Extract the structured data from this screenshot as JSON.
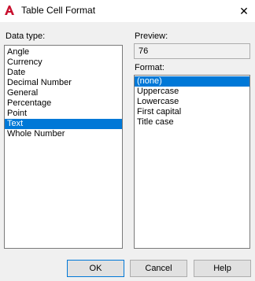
{
  "window": {
    "title": "Table Cell Format",
    "app_icon": "autocad-a-icon",
    "close_glyph": "✕"
  },
  "data_type": {
    "label": "Data type:",
    "items": [
      "Angle",
      "Currency",
      "Date",
      "Decimal Number",
      "General",
      "Percentage",
      "Point",
      "Text",
      "Whole Number"
    ],
    "selected": "Text"
  },
  "preview": {
    "label": "Preview:",
    "value": "76"
  },
  "format": {
    "label": "Format:",
    "items": [
      "(none)",
      "Uppercase",
      "Lowercase",
      "First capital",
      "Title case"
    ],
    "selected": "(none)"
  },
  "buttons": {
    "ok": "OK",
    "cancel": "Cancel",
    "help": "Help"
  },
  "colors": {
    "selection": "#0078d7",
    "brand_red": "#c8102e"
  }
}
